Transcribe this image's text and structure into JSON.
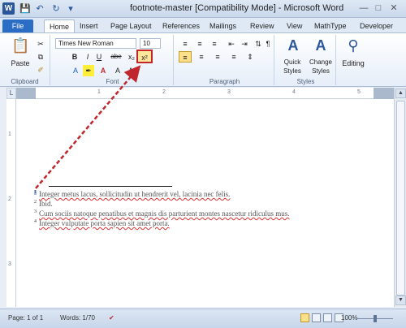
{
  "titlebar": {
    "app_icon": "W",
    "title": "footnote-master [Compatibility Mode] - Microsoft Word",
    "qat": [
      "save-icon",
      "undo-icon",
      "redo-icon",
      "customize-icon"
    ],
    "controls": [
      "minimize-icon",
      "maximize-icon",
      "close-icon"
    ]
  },
  "tabs": [
    "File",
    "Home",
    "Insert",
    "Page Layout",
    "References",
    "Mailings",
    "Review",
    "View",
    "MathType",
    "Developer"
  ],
  "ribbon": {
    "clipboard": {
      "paste": "Paste",
      "label": "Clipboard"
    },
    "font": {
      "font_name": "Times New Roman",
      "font_size": "10",
      "bold": "B",
      "italic": "I",
      "underline": "U",
      "strike": "abe",
      "subscript": "x₂",
      "superscript": "x²",
      "label": "Font"
    },
    "paragraph": {
      "label": "Paragraph"
    },
    "styles": {
      "quick": "Quick Styles",
      "change": "Change Styles",
      "label": "Styles"
    },
    "editing": {
      "label": "Editing"
    }
  },
  "ruler": {
    "ticks": [
      "1",
      "2",
      "3",
      "4",
      "5"
    ],
    "vticks": [
      "1",
      "2",
      "3"
    ]
  },
  "document": {
    "footnotes": [
      {
        "mark": "1",
        "text": "Integer metus lacus, sollicitudin ut hendrerit vel, lacinia nec felis."
      },
      {
        "mark": "2",
        "text": "Ibid."
      },
      {
        "mark": "3",
        "text": "Cum sociis natoque penatibus et magnis dis parturient montes nascetur ridiculus mus."
      },
      {
        "mark": "4",
        "text": "Integer vulputate porta sapien sit amet porta."
      }
    ]
  },
  "statusbar": {
    "page": "Page: 1 of 1",
    "words": "Words: 1/70",
    "zoom": "100%"
  },
  "colors": {
    "accent": "#2b579a",
    "annotation": "#c0262c"
  }
}
